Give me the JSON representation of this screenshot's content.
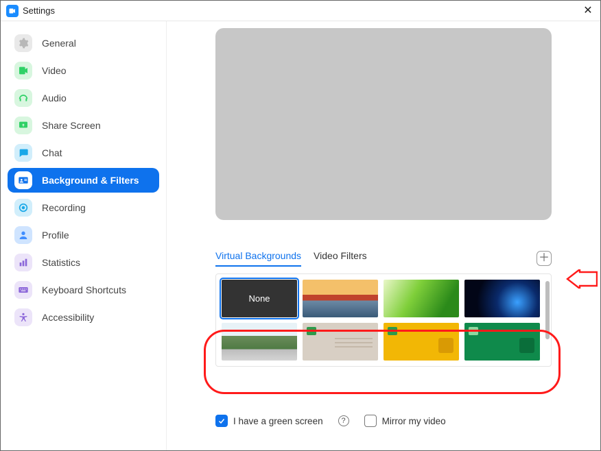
{
  "title": "Settings",
  "sidebar": {
    "items": [
      {
        "label": "General",
        "icon": "gear",
        "bg": "#e9e9e9",
        "fg": "#b8b8b8"
      },
      {
        "label": "Video",
        "icon": "video",
        "bg": "#d8f6df",
        "fg": "#2fd166"
      },
      {
        "label": "Audio",
        "icon": "audio",
        "bg": "#d8f6df",
        "fg": "#2fd166"
      },
      {
        "label": "Share Screen",
        "icon": "share",
        "bg": "#d8f6df",
        "fg": "#2fd166"
      },
      {
        "label": "Chat",
        "icon": "chat",
        "bg": "#d1eefb",
        "fg": "#1aa8e8"
      },
      {
        "label": "Background & Filters",
        "icon": "profile-card",
        "bg": "#ffffff",
        "fg": "#ffffff",
        "active": true
      },
      {
        "label": "Recording",
        "icon": "record",
        "bg": "#d1eefb",
        "fg": "#1aa8e8"
      },
      {
        "label": "Profile",
        "icon": "user",
        "bg": "#cfe4ff",
        "fg": "#3f8dff"
      },
      {
        "label": "Statistics",
        "icon": "stats",
        "bg": "#ece4f9",
        "fg": "#8b66d9"
      },
      {
        "label": "Keyboard Shortcuts",
        "icon": "keyboard",
        "bg": "#ece4f9",
        "fg": "#8b66d9"
      },
      {
        "label": "Accessibility",
        "icon": "accessibility",
        "bg": "#ece4f9",
        "fg": "#8b66d9"
      }
    ]
  },
  "tabs": {
    "virtual_backgrounds": "Virtual Backgrounds",
    "video_filters": "Video Filters",
    "active": "virtual_backgrounds"
  },
  "add_button_title": "Add Image or Video",
  "thumbnails": [
    {
      "name": "none",
      "label": "None",
      "selected": true
    },
    {
      "name": "golden-gate"
    },
    {
      "name": "grass"
    },
    {
      "name": "earth-space"
    },
    {
      "name": "campus-hill"
    },
    {
      "name": "beige-slide"
    },
    {
      "name": "orange-slide"
    },
    {
      "name": "green-slide"
    }
  ],
  "options": {
    "green_screen_label": "I have a green screen",
    "green_screen_checked": true,
    "mirror_label": "Mirror my video",
    "mirror_checked": false
  }
}
